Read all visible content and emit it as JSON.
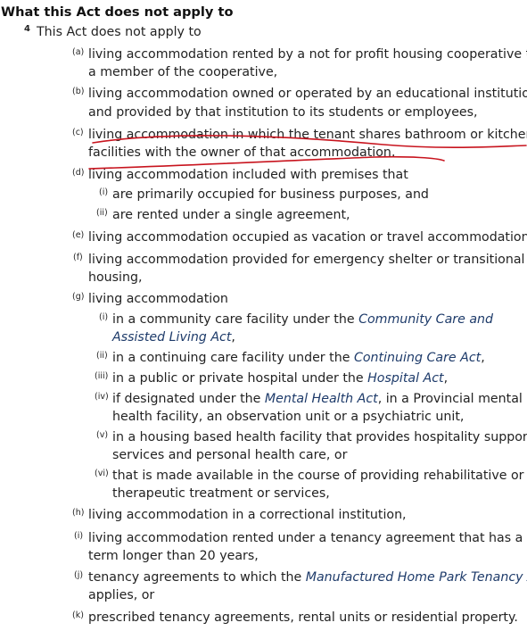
{
  "heading": "What this Act does not apply to",
  "section": {
    "number": "4",
    "intro": "This Act does not apply to"
  },
  "markers": {
    "a": "(a)",
    "b": "(b)",
    "c": "(c)",
    "d": "(d)",
    "e": "(e)",
    "f": "(f)",
    "g": "(g)",
    "h": "(h)",
    "i": "(i)",
    "j": "(j)",
    "k": "(k)",
    "r1": "(i)",
    "r2": "(ii)",
    "r3": "(iii)",
    "r4": "(iv)",
    "r5": "(v)",
    "r6": "(vi)"
  },
  "items": {
    "a": {
      "l1": "living accommodation rented by a not for profit housing cooperative to",
      "l2": "a member of the cooperative,"
    },
    "b": {
      "l1": "living accommodation owned or operated by an educational institution",
      "l2": "and provided by that institution to its students or employees,"
    },
    "c": {
      "l1": "living accommodation in which the tenant shares bathroom or kitchen",
      "l2": "facilities with the owner of that accommodation,"
    },
    "d": {
      "l1": "living accommodation included with premises that",
      "i": "are primarily occupied for business purposes, and",
      "ii": "are rented under a single agreement,"
    },
    "e": {
      "l1": "living accommodation occupied as vacation or travel accommodation,"
    },
    "f": {
      "l1": "living accommodation provided for emergency shelter or transitional",
      "l2": "housing,"
    },
    "g": {
      "l1": "living accommodation",
      "i": {
        "pre": "in a community care facility under the ",
        "act": "Community Care and",
        "act2": "Assisted Living Act",
        "post": ","
      },
      "ii": {
        "pre": "in a continuing care facility under the ",
        "act": "Continuing Care Act",
        "post": ","
      },
      "iii": {
        "pre": "in a public or private hospital under the ",
        "act": "Hospital Act",
        "post": ","
      },
      "iv": {
        "pre": "if designated under the ",
        "act": "Mental Health Act",
        "post": ", in a Provincial mental",
        "l2": "health facility, an observation unit or a psychiatric unit,"
      },
      "v": {
        "l1": "in a housing based health facility that provides hospitality support",
        "l2": "services and personal health care, or"
      },
      "vi": {
        "l1": "that is made available in the course of providing rehabilitative or",
        "l2": "therapeutic treatment or services,"
      }
    },
    "h": {
      "l1": "living accommodation in a correctional institution,"
    },
    "i": {
      "l1": "living accommodation rented under a tenancy agreement that has a",
      "l2": "term longer than 20 years,"
    },
    "j": {
      "pre": "tenancy agreements to which the ",
      "act": "Manufactured Home Park Tenancy A",
      "l2": "applies, or"
    },
    "k": {
      "l1": "prescribed tenancy agreements, rental units or residential property."
    }
  },
  "colors": {
    "text": "#222222",
    "link": "#1e3b6a",
    "annotation": "#c8141e"
  }
}
